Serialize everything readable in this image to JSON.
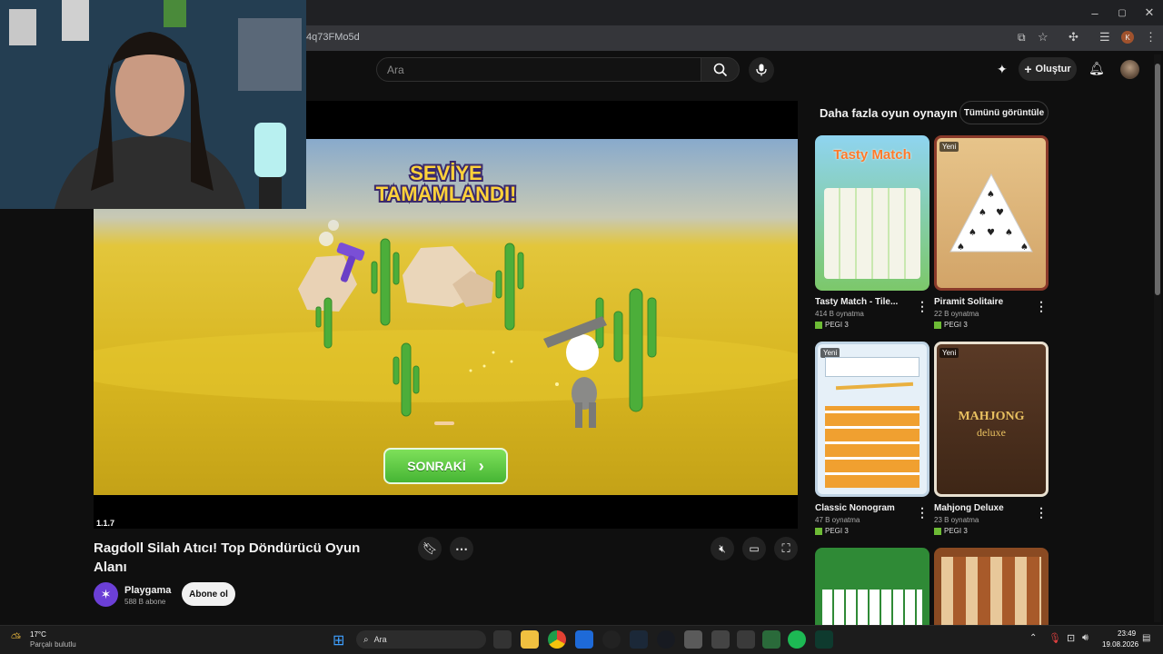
{
  "browser": {
    "url": "4q73FMo5d",
    "window_buttons": [
      "–",
      "▢",
      "✕"
    ]
  },
  "header": {
    "search_placeholder": "Ara",
    "create_label": "Oluştur"
  },
  "game": {
    "level_text_1": "SEVİYE",
    "level_text_2": "TAMAMLANDI!",
    "next_label": "SONRAKİ",
    "version": "1.1.7"
  },
  "video": {
    "title": "Ragdoll Silah Atıcı! Top Döndürücü Oyun Alanı",
    "channel_name": "Playgama",
    "channel_subs": "588 B abone",
    "subscribe_label": "Abone ol"
  },
  "sidebar": {
    "title": "Daha fazla oyun oynayın",
    "view_all": "Tümünü görüntüle",
    "new_badge": "Yeni",
    "cards": [
      {
        "title": "Tasty Match - Tile...",
        "plays": "414 B oynatma",
        "rating": "PEGI 3",
        "thumb_text": "Tasty Match"
      },
      {
        "title": "Piramit Solitaire",
        "plays": "22 B oynatma",
        "rating": "PEGI 3"
      },
      {
        "title": "Classic Nonogram",
        "plays": "47 B oynatma",
        "rating": "PEGI 3"
      },
      {
        "title": "Mahjong Deluxe",
        "plays": "23 B oynatma",
        "rating": "PEGI 3",
        "thumb_text": "MAHJONG",
        "thumb_sub": "deluxe"
      }
    ]
  },
  "taskbar": {
    "weather_temp": "17°C",
    "weather_desc": "Parçalı bulutlu",
    "search_label": "Ara",
    "time": "23:49",
    "date": "19.08.2026"
  }
}
